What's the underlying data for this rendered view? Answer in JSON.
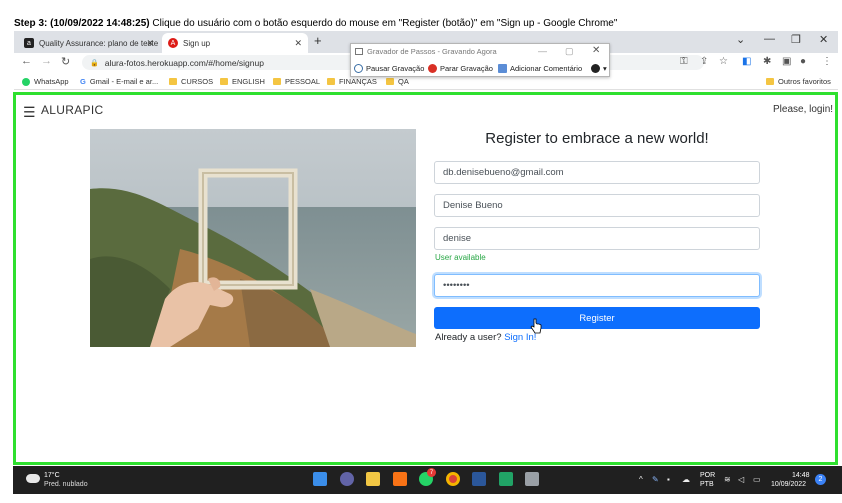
{
  "step_caption": {
    "prefix": "Step 3: (10/09/2022 14:48:25)",
    "text": " Clique do usuário com o botão esquerdo do mouse em \"Register (botão)\" em \"Sign up - Google Chrome\""
  },
  "browser": {
    "tabs": [
      {
        "label": "Quality Assurance: plano de teste",
        "active": false
      },
      {
        "label": "Sign up",
        "active": true
      }
    ],
    "url": "alura-fotos.herokuapp.com/#/home/signup",
    "bookmarks": [
      "WhatsApp",
      "Gmail - E-mail e ar...",
      "CURSOS",
      "ENGLISH",
      "PESSOAL",
      "FINANÇAS",
      "QA"
    ],
    "other_bookmarks": "Outros favoritos"
  },
  "recorder": {
    "title": "Gravador de Passos - Gravando Agora",
    "pause": "Pausar Gravação",
    "stop": "Parar Gravação",
    "add_comment": "Adicionar Comentário"
  },
  "app": {
    "brand": "ALURAPIC",
    "login_prompt": "Please, login!",
    "form_title": "Register to embrace a new world!",
    "email_value": "db.denisebueno@gmail.com",
    "fullname_value": "Denise Bueno",
    "username_value": "denise",
    "username_status": "User available",
    "password_value": "••••••••",
    "register_label": "Register",
    "already_user": "Already a user?",
    "sign_in_label": "Sign In!"
  },
  "taskbar": {
    "temperature": "17°C",
    "weather": "Pred. nublado",
    "lang_line1": "POR",
    "lang_line2": "PTB",
    "time": "14:48",
    "date": "10/09/2022",
    "notification_count": "2",
    "whatsapp_badge": "7"
  },
  "colors": {
    "highlight_border": "#2ee02e",
    "primary_button": "#0d6efd",
    "success_text": "#28a745"
  }
}
